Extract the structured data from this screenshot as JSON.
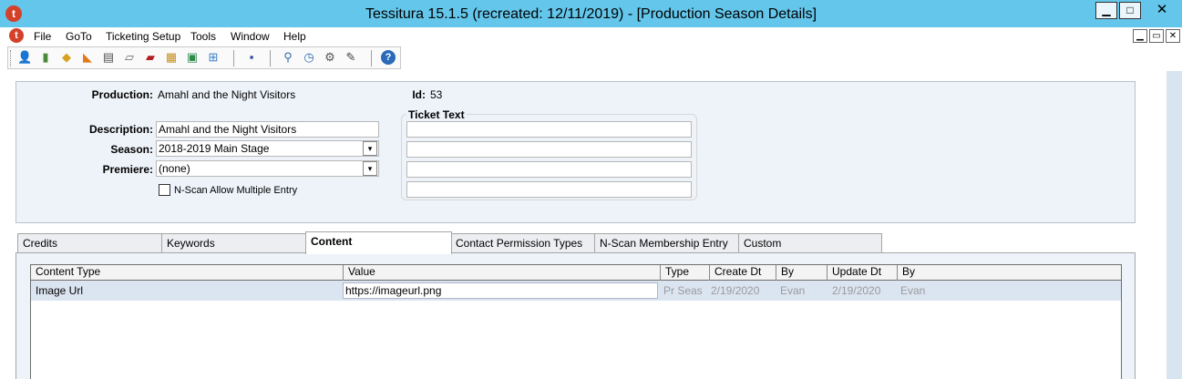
{
  "window": {
    "logo_letter": "t",
    "title": "Tessitura  15.1.5 (recreated: 12/11/2019) - [Production Season Details]",
    "minimize": "▁",
    "maximize": "□",
    "close": "✕"
  },
  "menu": {
    "logo_letter": "t",
    "items": [
      "File",
      "GoTo",
      "Ticketing Setup",
      "Tools",
      "Window",
      "Help"
    ],
    "mdi_controls": [
      "▁",
      "▭",
      "✕"
    ]
  },
  "toolbar": {
    "icons": [
      {
        "name": "constituent-icon",
        "glyph": "👤",
        "color": "#3a7bc8"
      },
      {
        "name": "report-icon",
        "glyph": "▮",
        "color": "#4a8a3a"
      },
      {
        "name": "order-icon",
        "glyph": "◆",
        "color": "#d8a020"
      },
      {
        "name": "ticket-icon",
        "glyph": "◣",
        "color": "#e07a1a"
      },
      {
        "name": "document-icon",
        "glyph": "▤",
        "color": "#555555"
      },
      {
        "name": "list-icon",
        "glyph": "▱",
        "color": "#666666"
      },
      {
        "name": "book-icon",
        "glyph": "▰",
        "color": "#b02020"
      },
      {
        "name": "grid-icon",
        "glyph": "▦",
        "color": "#c89020"
      },
      {
        "name": "excel-icon",
        "glyph": "▣",
        "color": "#2c8a4a"
      },
      {
        "name": "flow-icon",
        "glyph": "⊞",
        "color": "#3a7bc8"
      },
      {
        "name": "save-icon",
        "glyph": "▪",
        "color": "#2a4a9a"
      },
      {
        "name": "search-icon",
        "glyph": "⚲",
        "color": "#3a6ab0"
      },
      {
        "name": "clock-icon",
        "glyph": "◷",
        "color": "#2a6ab8"
      },
      {
        "name": "gear-icon",
        "glyph": "⚙",
        "color": "#555555"
      },
      {
        "name": "notes-icon",
        "glyph": "✎",
        "color": "#444444"
      },
      {
        "name": "help-icon",
        "glyph": "?",
        "color": "#ffffff"
      }
    ]
  },
  "header": {
    "production_label": "Production:",
    "production_value": "Amahl and the Night Visitors",
    "id_label": "Id:",
    "id_value": "53",
    "description_label": "Description:",
    "description_value": "Amahl and the Night Visitors",
    "season_label": "Season:",
    "season_value": "2018-2019 Main Stage",
    "premiere_label": "Premiere:",
    "premiere_value": "(none)",
    "nscan_label": "N-Scan Allow Multiple Entry",
    "nscan_checked": false,
    "ticket_text_label": "Ticket Text",
    "ticket_text_lines": [
      "",
      "",
      "",
      ""
    ],
    "dropdown_glyph": "▾"
  },
  "tabs": [
    {
      "label": "Credits",
      "active": false
    },
    {
      "label": "Keywords",
      "active": false
    },
    {
      "label": "Content",
      "active": true
    },
    {
      "label": "Contact Permission Types",
      "active": false
    },
    {
      "label": "N-Scan Membership Entry",
      "active": false
    },
    {
      "label": "Custom",
      "active": false
    }
  ],
  "grid": {
    "columns": [
      "Content Type",
      "Value",
      "Type",
      "Create Dt",
      "By",
      "Update Dt",
      "By"
    ],
    "rows": [
      {
        "content_type": "Image Url",
        "value": "https://imageurl.png",
        "type": "Pr Seas",
        "create_dt": "2/19/2020",
        "created_by": "Evan",
        "update_dt": "2/19/2020",
        "updated_by": "Evan"
      }
    ]
  }
}
